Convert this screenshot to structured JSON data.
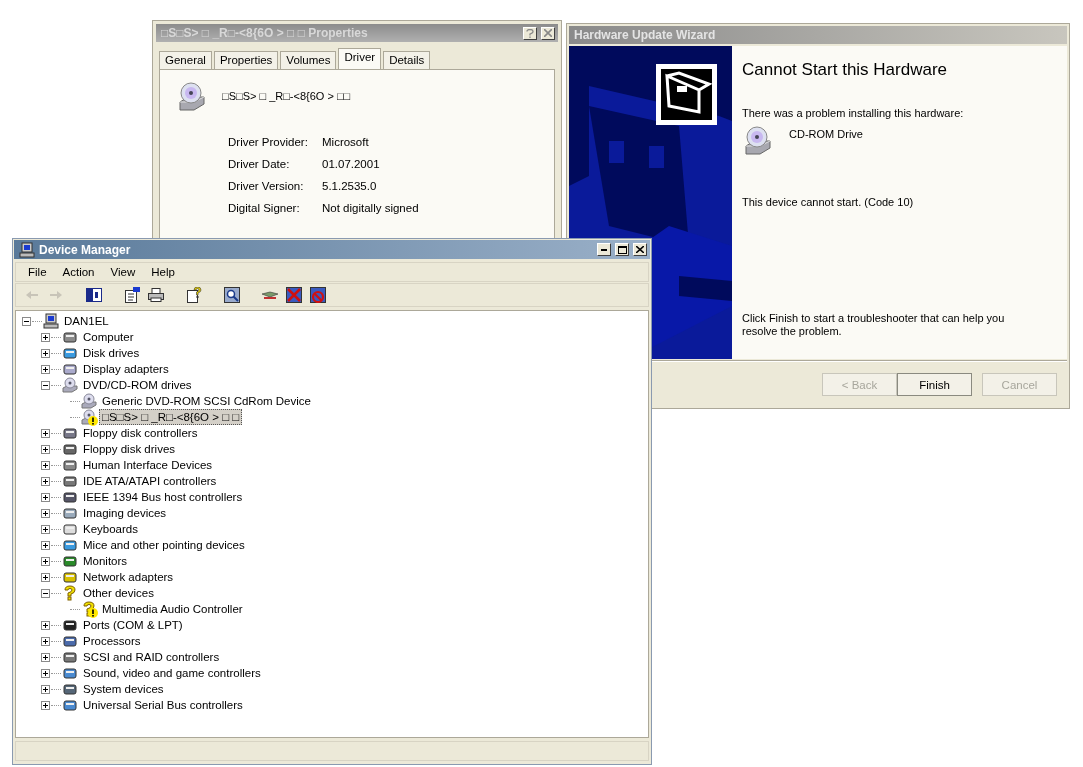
{
  "properties_window": {
    "title": "□S□S> □ _R□-<8{6O > □ □ Properties",
    "tabs": [
      {
        "label": "General",
        "selected": false
      },
      {
        "label": "Properties",
        "selected": false
      },
      {
        "label": "Volumes",
        "selected": false
      },
      {
        "label": "Driver",
        "selected": true
      },
      {
        "label": "Details",
        "selected": false
      }
    ],
    "device_name": "□S□S> □ _R□-<8{6O > □□",
    "fields": [
      {
        "label": "Driver Provider:",
        "value": "Microsoft"
      },
      {
        "label": "Driver Date:",
        "value": "01.07.2001"
      },
      {
        "label": "Driver Version:",
        "value": "5.1.2535.0"
      },
      {
        "label": "Digital Signer:",
        "value": "Not digitally signed"
      }
    ]
  },
  "wizard": {
    "title": "Hardware Update Wizard",
    "heading": "Cannot Start this Hardware",
    "message": "There was a problem installing this hardware:",
    "device": "CD-ROM Drive",
    "status": "This device cannot start. (Code 10)",
    "hint": "Click Finish to start a troubleshooter that can help you resolve the problem.",
    "buttons": [
      {
        "label": "< Back",
        "disabled": true
      },
      {
        "label": "Finish",
        "disabled": false
      },
      {
        "label": "Cancel",
        "disabled": true
      }
    ]
  },
  "device_manager": {
    "title": "Device Manager",
    "menu": [
      "File",
      "Action",
      "View",
      "Help"
    ],
    "toolbar": {
      "back_disabled": true,
      "forward_disabled": true
    },
    "tree": {
      "label": "DAN1EL",
      "expanded": true,
      "selected": false,
      "children": [
        {
          "label": "Computer",
          "expanded": false,
          "selected": false
        },
        {
          "label": "Disk drives",
          "expanded": false,
          "selected": false
        },
        {
          "label": "Display adapters",
          "expanded": false,
          "selected": false
        },
        {
          "label": "DVD/CD-ROM drives",
          "expanded": true,
          "selected": false,
          "children": [
            {
              "label": "Generic DVD-ROM SCSI CdRom Device",
              "selected": false,
              "problem": false
            },
            {
              "label": "□S□S> □ _R□-<8{6O > □ □",
              "selected": true,
              "problem": true
            }
          ]
        },
        {
          "label": "Floppy disk controllers",
          "expanded": false,
          "selected": false
        },
        {
          "label": "Floppy disk drives",
          "expanded": false,
          "selected": false
        },
        {
          "label": "Human Interface Devices",
          "expanded": false,
          "selected": false
        },
        {
          "label": "IDE ATA/ATAPI controllers",
          "expanded": false,
          "selected": false
        },
        {
          "label": "IEEE 1394 Bus host controllers",
          "expanded": false,
          "selected": false
        },
        {
          "label": "Imaging devices",
          "expanded": false,
          "selected": false
        },
        {
          "label": "Keyboards",
          "expanded": false,
          "selected": false
        },
        {
          "label": "Mice and other pointing devices",
          "expanded": false,
          "selected": false
        },
        {
          "label": "Monitors",
          "expanded": false,
          "selected": false
        },
        {
          "label": "Network adapters",
          "expanded": false,
          "selected": false
        },
        {
          "label": "Other devices",
          "expanded": true,
          "selected": false,
          "children": [
            {
              "label": "Multimedia Audio Controller",
              "selected": false,
              "problem": true
            }
          ]
        },
        {
          "label": "Ports (COM & LPT)",
          "expanded": false,
          "selected": false
        },
        {
          "label": "Processors",
          "expanded": false,
          "selected": false
        },
        {
          "label": "SCSI and RAID controllers",
          "expanded": false,
          "selected": false
        },
        {
          "label": "Sound, video and game controllers",
          "expanded": false,
          "selected": false
        },
        {
          "label": "System devices",
          "expanded": false,
          "selected": false
        },
        {
          "label": "Universal Serial Bus controllers",
          "expanded": false,
          "selected": false
        }
      ]
    }
  }
}
